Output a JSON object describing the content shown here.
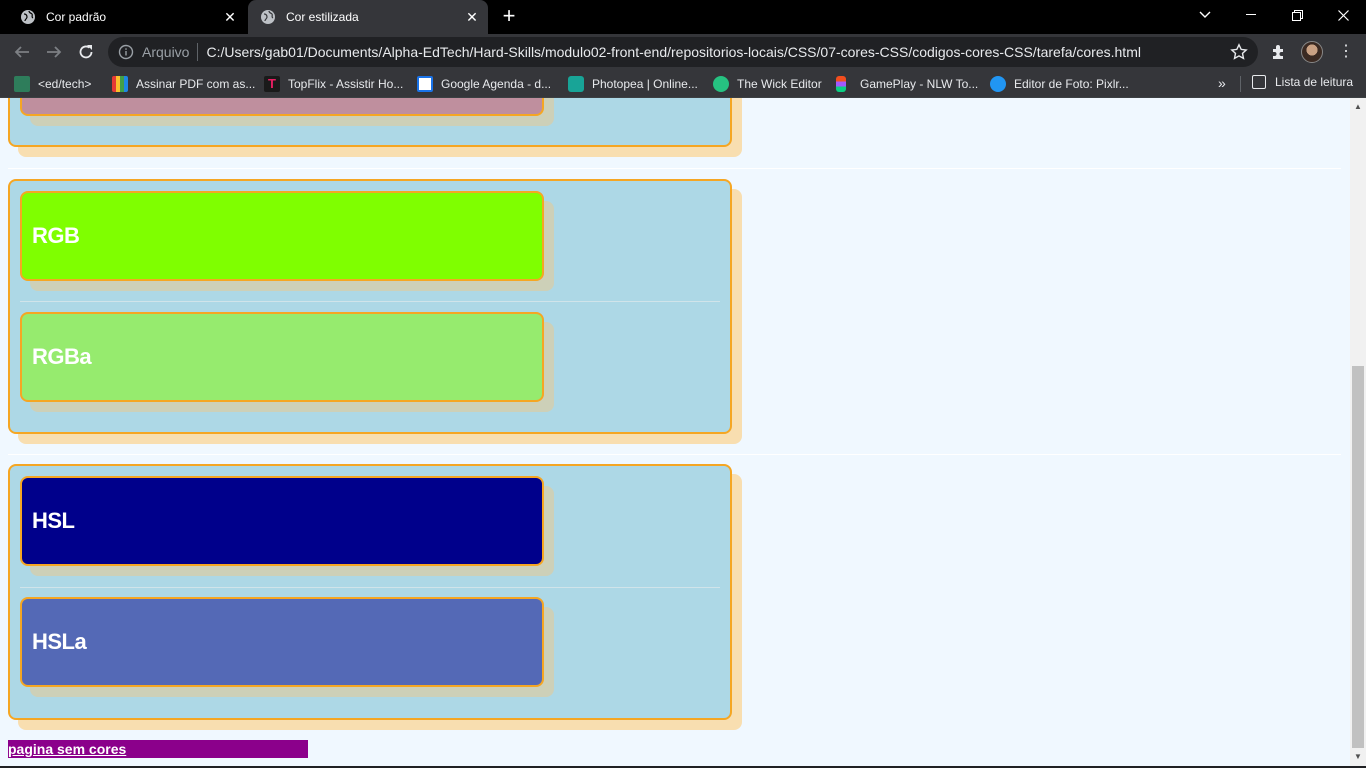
{
  "browser": {
    "tabs": [
      {
        "title": "Cor padrão"
      },
      {
        "title": "Cor estilizada"
      }
    ],
    "address": {
      "scheme_label": "Arquivo",
      "url": "C:/Users/gab01/Documents/Alpha-EdTech/Hard-Skills/modulo02-front-end/repositorios-locais/CSS/07-cores-CSS/codigos-cores-CSS/tarefa/cores.html"
    },
    "bookmarks": [
      {
        "label": "<ed/tech>",
        "color": "#2e7d5b"
      },
      {
        "label": "Assinar PDF com as...",
        "color": "#e53935"
      },
      {
        "label": "TopFlix - Assistir Ho...",
        "color": "#c2185b"
      },
      {
        "label": "Google Agenda - d...",
        "color": "#1a73e8"
      },
      {
        "label": "Photopea | Online...",
        "color": "#18a497"
      },
      {
        "label": "The Wick Editor",
        "color": "#26c281"
      },
      {
        "label": "GamePlay - NLW To...",
        "color": "#f24e1e"
      },
      {
        "label": "Editor de Foto: Pixlr...",
        "color": "#2196f3"
      }
    ],
    "reading_list": "Lista de leitura"
  },
  "page": {
    "sections": [
      {
        "cards": [
          {
            "label": "RGB",
            "bg": "#7fff00"
          },
          {
            "label": "RGBa",
            "bg": "#96eb6e"
          }
        ]
      },
      {
        "cards": [
          {
            "label": "HSL",
            "bg": "#00008b"
          },
          {
            "label": "HSLa",
            "bg": "#5469b6"
          }
        ]
      }
    ],
    "footer_link": "pagina sem cores"
  }
}
